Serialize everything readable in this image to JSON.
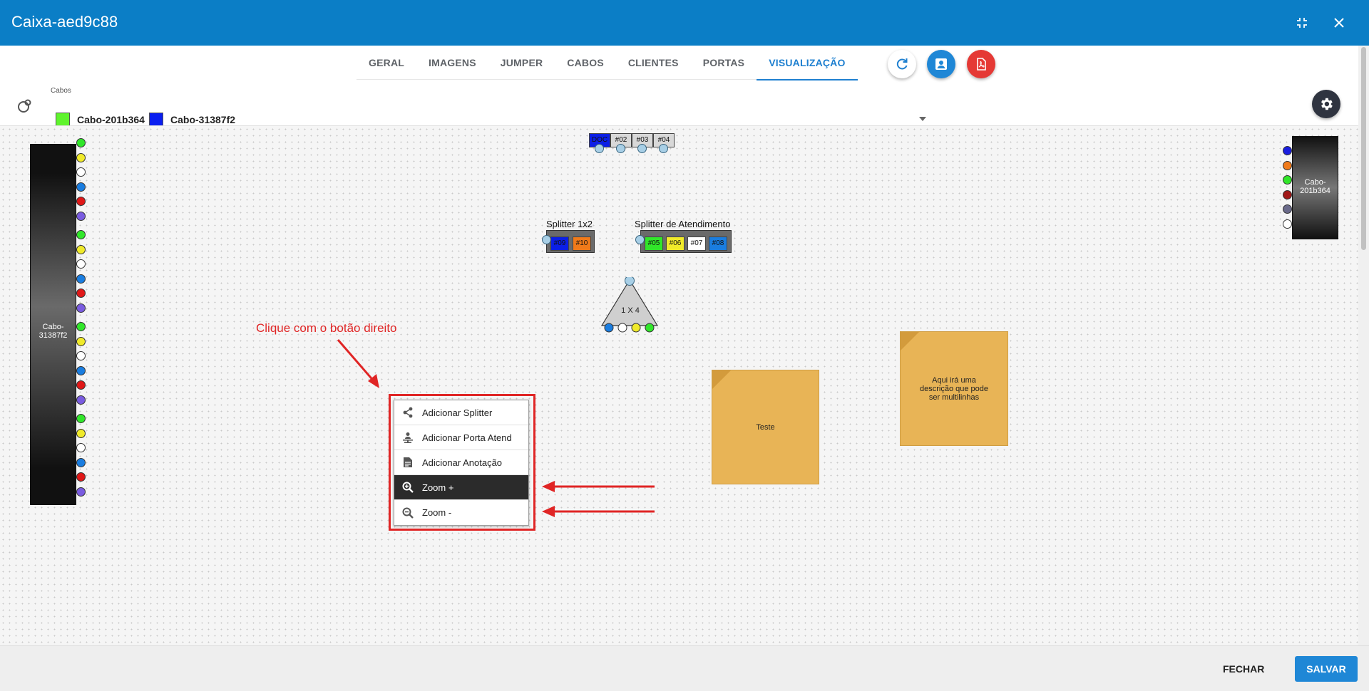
{
  "window": {
    "title": "Caixa-aed9c88"
  },
  "tabs": [
    {
      "label": "GERAL"
    },
    {
      "label": "IMAGENS"
    },
    {
      "label": "JUMPER"
    },
    {
      "label": "CABOS"
    },
    {
      "label": "CLIENTES"
    },
    {
      "label": "PORTAS"
    },
    {
      "label": "VISUALIZAÇÃO",
      "active": true
    }
  ],
  "cabos": {
    "label": "Cabos",
    "items": [
      {
        "label": "Cabo-201b364",
        "color": "#5ff42d"
      },
      {
        "label": "Cabo-31387f2",
        "color": "#0a1ef0"
      }
    ]
  },
  "canvas": {
    "left_cable_label": "Cabo-31387f2",
    "right_cable_label": "Cabo-201b364",
    "top_ports": [
      "DOC",
      "#02",
      "#03",
      "#04"
    ],
    "splitter_1x2": {
      "title": "Splitter 1x2",
      "ports": [
        "#09",
        "#10"
      ]
    },
    "splitter_atend": {
      "title": "Splitter de Atendimento",
      "ports": [
        "#05",
        "#06",
        "#07",
        "#08"
      ]
    },
    "triangle_label": "1 X 4",
    "notes": [
      {
        "text": "Teste"
      },
      {
        "text": "Aqui irá uma descrição que pode ser multilinhas"
      }
    ],
    "annotation": "Clique com o botão direito"
  },
  "context_menu": {
    "items": [
      {
        "label": "Adicionar Splitter",
        "icon": "share-icon"
      },
      {
        "label": "Adicionar Porta Atend",
        "icon": "person-port-icon"
      },
      {
        "label": "Adicionar Anotação",
        "icon": "note-icon"
      },
      {
        "label": "Zoom +",
        "icon": "zoom-in-icon",
        "active": true
      },
      {
        "label": "Zoom -",
        "icon": "zoom-out-icon"
      }
    ]
  },
  "footer": {
    "close_label": "FECHAR",
    "save_label": "SALVAR"
  },
  "colors": {
    "primary": "#0b7ec6",
    "accent": "#1f80d0",
    "danger": "#e53935",
    "annotation": "#e02525"
  }
}
